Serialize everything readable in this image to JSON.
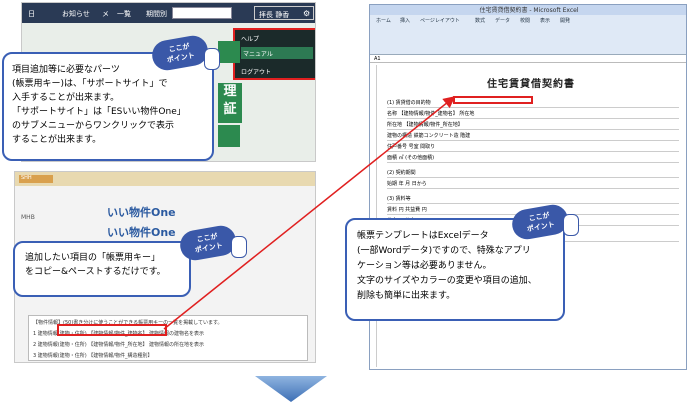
{
  "top_app": {
    "menu_items": [
      "日",
      "お知らせ",
      "メ",
      "一覧",
      "期間別"
    ],
    "user_label": "拝長  静香",
    "dropdown": {
      "help": "ヘルプ",
      "manual": "マニュアル",
      "logout": "ログアウト"
    },
    "green_label": "理\n証"
  },
  "badge_text": "ここが\nポイント",
  "callout1": {
    "lines": [
      "項目追加等に必要なパーツ",
      "(帳票用キー)は、「サポートサイト」で",
      "入手することが出来ます。",
      "「サポートサイト」は「ESいい物件One」",
      "のサブメニューからワンクリックで表示",
      "することが出来ます。"
    ]
  },
  "mid_app": {
    "tag": "SHH",
    "logo_a": "いい物件One",
    "logo_b": "いい物件One",
    "side_label": "MHB",
    "table_rows": [
      "【物件情報】(50)書き分けに使うことができる帳票用キーの一覧を掲載しています。",
      "1  建物情報(建物・住所) 【建物情報/物件_建物名】  建物情報の建物名を表示",
      "2  建物情報(建物・住所) 【建物情報/物件_所在地】  建物情報の所在地を表示",
      "3  建物情報(建物・住所) 【建物情報/物件_構造種別】"
    ]
  },
  "callout2": {
    "lines": [
      "追加したい項目の「帳票用キー」",
      "をコピー&ペーストするだけです。"
    ]
  },
  "excel": {
    "title": "住宅賃貸借契約書 - Microsoft Excel",
    "tabs": [
      "ホーム",
      "挿入",
      "ページレイアウト",
      "数式",
      "データ",
      "校閲",
      "表示",
      "開発"
    ],
    "cell_ref": "A1",
    "doc_title": "住宅賃貸借契約書",
    "rows": [
      "(1) 賃貸借の目的物",
      "名称  【建物情報/物件_建物名】  所在地",
      "所在地  【建物情報/物件_所在地】",
      "建物の構造  鉄筋コンクリート造  階建",
      "住戸番号  号室  間取り",
      "面積  ㎡  (その他面積)",
      "(2) 契約期間",
      "始期  年  月  日から",
      "(3) 賃料等",
      "賃料  円  共益費  円",
      "敷金  円  礼金  円",
      "(4) 貸主・管理業者"
    ]
  },
  "callout3": {
    "lines": [
      "帳票テンプレートはExcelデータ",
      "(一部Wordデータ)ですので、特殊なアプリ",
      "ケーション等は必要ありません。",
      "文字のサイズやカラーの変更や項目の追加、",
      "削除も簡単に出来ます。"
    ]
  },
  "colors": {
    "accent_blue": "#3a5fb5",
    "highlight_red": "#e02020",
    "green": "#2c8a4f"
  }
}
